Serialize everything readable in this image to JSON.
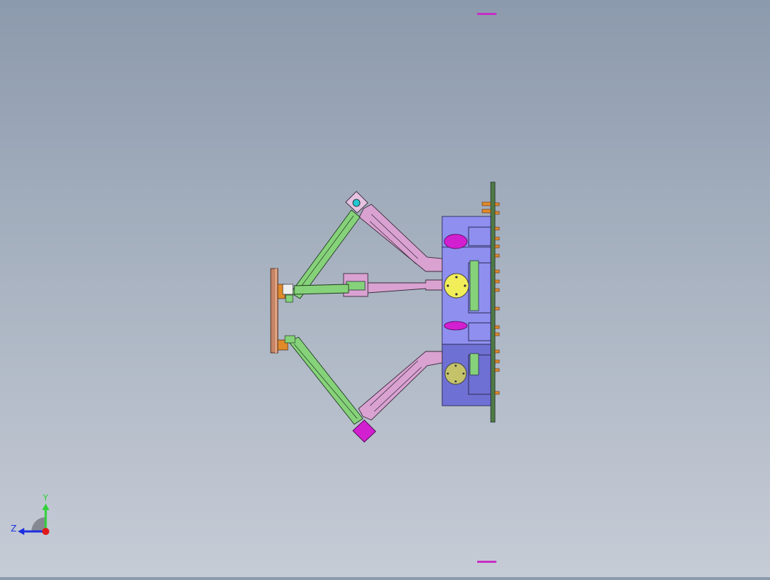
{
  "viewport": {
    "background_top": "#8c9aad",
    "background_bottom": "#c6ccd6"
  },
  "triad": {
    "y_label": "Y",
    "z_label": "Z",
    "y_color": "#2fd23a",
    "z_color": "#1c2fe0",
    "x_color": "#e01a1a"
  },
  "model": {
    "base_color": "#8f8ff0",
    "plate_color": "#4f7a44",
    "upper_arm_color": "#d9a2d1",
    "lower_arm_color": "#86d27a",
    "motor_color": "#e6e25a",
    "joint_color": "#d21fd0",
    "effector_color": "#c58466"
  }
}
